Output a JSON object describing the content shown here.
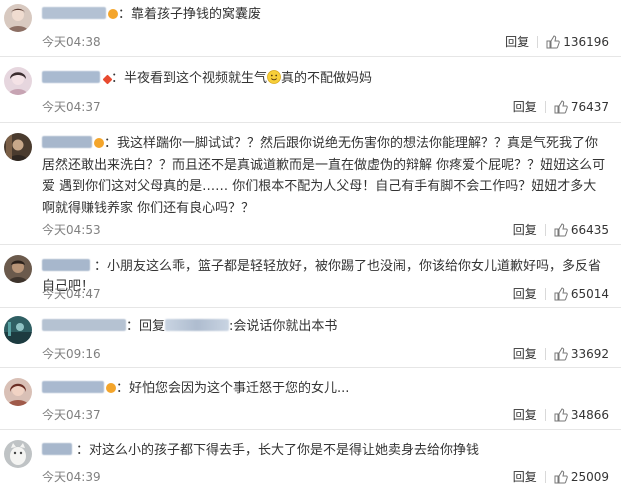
{
  "comments": [
    {
      "name_hidden": "",
      "text": "：靠着孩子挣钱的窝囊废",
      "time": "今天04:38",
      "reply": "回复",
      "likes": "136196"
    },
    {
      "name_hidden": "",
      "text_a": "：半夜看到这个视频就生气",
      "text_b": "真的不配做妈妈",
      "time": "今天04:37",
      "reply": "回复",
      "likes": "76437"
    },
    {
      "name_hidden": "",
      "text": "：我这样踹你一脚试试？？然后跟你说绝无伤害你的想法你能理解？？真是气死我了你居然还敢出来洗白？？而且还不是真诚道歉而是一直在做虚伪的辩解 你疼爱个屁呢？？妞妞这么可爱 遇到你们这对父母真的是…… 你们根本不配为人父母！自己有手有脚不会工作吗？妞妞才多大啊就得赚钱养家 你们还有良心吗？？",
      "time": "今天04:53",
      "reply": "回复",
      "likes": "66435"
    },
    {
      "name_hidden": "",
      "text": "：小朋友这么乖，篮子都是轻轻放好，被你踢了也没闹，你该给你女儿道歉好吗，多反省自己吧！",
      "time": "今天04:47",
      "reply": "回复",
      "likes": "65014"
    },
    {
      "name_hidden": "",
      "text_a": "：回复",
      "text_b": ":会说话你就出本书",
      "time": "今天09:16",
      "reply": "回复",
      "likes": "33692"
    },
    {
      "name_hidden": "",
      "text": "：好怕您会因为这个事迁怒于您的女儿...",
      "time": "今天04:37",
      "reply": "回复",
      "likes": "34866"
    },
    {
      "name_hidden": "",
      "text": "：对这么小的孩子都下得去手，长大了你是不是得让她卖身去给你挣钱",
      "time": "今天04:39",
      "reply": "回复",
      "likes": "25009"
    }
  ],
  "colors": {
    "name_blur": "#a7b7cc",
    "time": "#808080",
    "badge": "#f4a52b"
  },
  "icons": {
    "like": "thumbs-up-icon",
    "vip": "vip-badge-icon",
    "smiley": "smiley-emoji-icon"
  }
}
